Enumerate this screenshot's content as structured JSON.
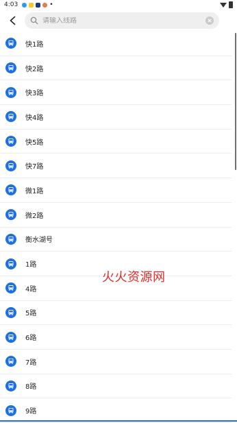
{
  "status_bar": {
    "time": "4:03",
    "dot": "•"
  },
  "search": {
    "placeholder": "请输入线路",
    "value": ""
  },
  "routes": [
    {
      "name": "快1路"
    },
    {
      "name": "快2路"
    },
    {
      "name": "快3路"
    },
    {
      "name": "快4路"
    },
    {
      "name": "快5路"
    },
    {
      "name": "快7路"
    },
    {
      "name": "微1路"
    },
    {
      "name": "微2路"
    },
    {
      "name": "衡水湖号"
    },
    {
      "name": "1路"
    },
    {
      "name": "4路"
    },
    {
      "name": "5路"
    },
    {
      "name": "6路"
    },
    {
      "name": "7路"
    },
    {
      "name": "8路"
    },
    {
      "name": "9路"
    }
  ],
  "watermark": "火火资源网",
  "colors": {
    "accent": "#1e6fe6",
    "watermark": "#e42b2b"
  }
}
